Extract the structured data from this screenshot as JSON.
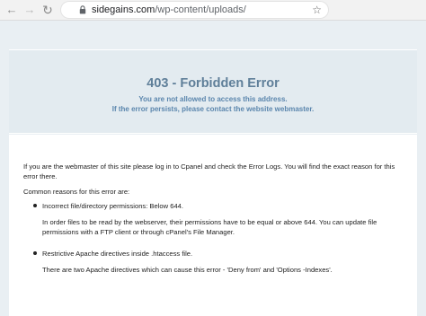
{
  "browser": {
    "url_host": "sidegains.com",
    "url_path": "/wp-content/uploads/",
    "back_icon": "arrow-left-icon",
    "forward_icon": "arrow-right-icon",
    "reload_icon": "reload-icon",
    "secure_icon": "lock-icon",
    "bookmark_icon": "star-icon"
  },
  "error": {
    "title": "403 - Forbidden Error",
    "subtitle_line1": "You are not allowed to access this address.",
    "subtitle_line2": "If the error persists, please contact the website webmaster."
  },
  "content": {
    "intro": "If you are the webmaster of this site please log in to Cpanel and check the Error Logs. You will find the exact reason for this error there.",
    "reasons_heading": "Common reasons for this error are:",
    "reasons": [
      {
        "title": "Incorrect file/directory permissions: Below 644.",
        "description": "In order files to be read by the webserver, their permissions have to be equal or above 644. You can update file permissions with a FTP client or through cPanel's File Manager."
      },
      {
        "title": "Restrictive Apache directives inside .htaccess file.",
        "description": "There are two Apache directives which can cause this error - 'Deny from' and 'Options -Indexes'."
      }
    ]
  },
  "colors": {
    "title": "#5f7f99",
    "subtitle": "#5b86ad",
    "page_background": "#e9eff3",
    "panel_background": "#ffffff"
  }
}
